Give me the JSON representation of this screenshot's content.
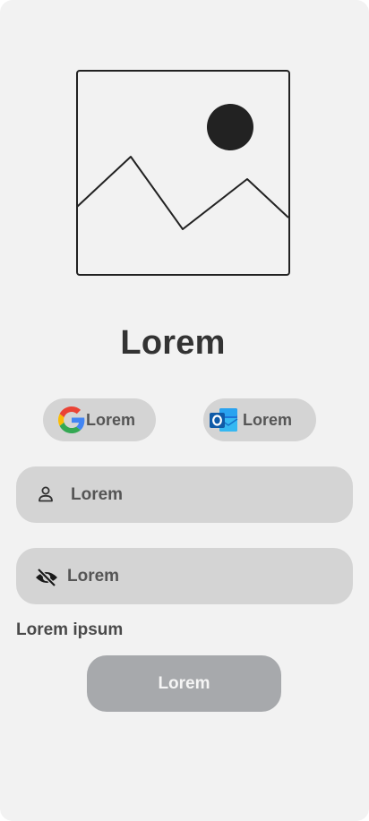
{
  "hero": {
    "icon": "image-placeholder-icon"
  },
  "title": "Lorem",
  "oauth": {
    "google": {
      "label": "Lorem",
      "icon": "google-icon"
    },
    "outlook": {
      "label": "Lorem",
      "icon": "outlook-icon"
    }
  },
  "form": {
    "username": {
      "placeholder": "Lorem",
      "icon": "user-icon"
    },
    "password": {
      "placeholder": "Lorem",
      "icon": "eye-off-icon"
    },
    "link": "Lorem ipsum",
    "submit": "Lorem"
  },
  "colors": {
    "background": "#f2f2f2",
    "field": "#d4d4d4",
    "submit": "#a7a9ac",
    "text": "#555555",
    "title": "#333333"
  }
}
